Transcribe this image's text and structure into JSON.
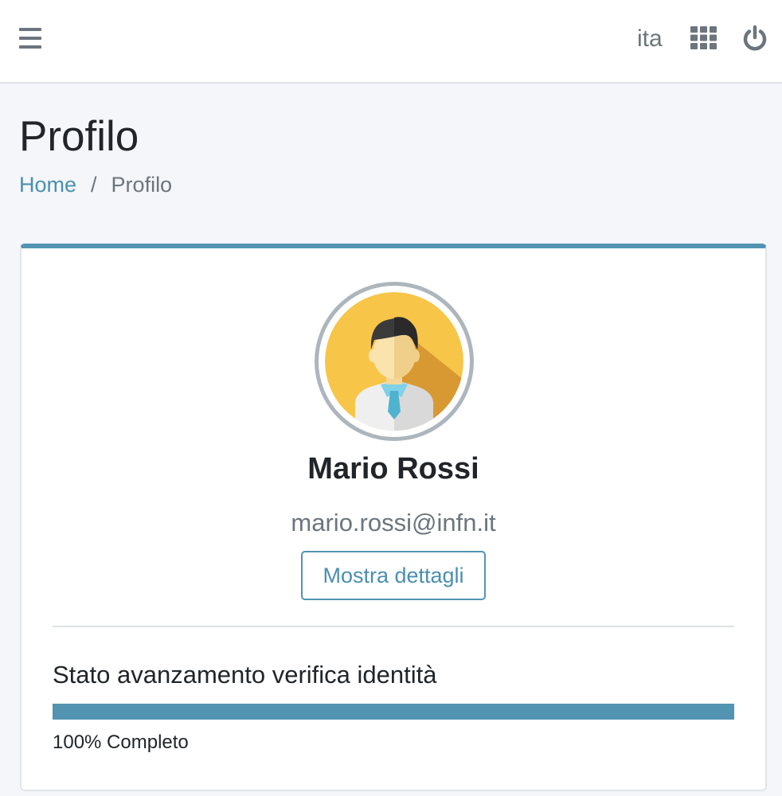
{
  "topbar": {
    "menu_icon": "hamburger-menu-icon",
    "language": "ita",
    "apps_icon": "grid-apps-icon",
    "power_icon": "power-icon"
  },
  "page": {
    "title": "Profilo",
    "breadcrumb": {
      "home": "Home",
      "separator": "/",
      "current": "Profilo"
    }
  },
  "profile": {
    "avatar_icon": "user-avatar-icon",
    "name": "Mario Rossi",
    "email": "mario.rossi@infn.it",
    "details_button": "Mostra dettagli"
  },
  "verification": {
    "title": "Stato avanzamento verifica identità",
    "progress_percent": 100,
    "progress_label": "100% Completo"
  },
  "colors": {
    "accent": "#5294b1",
    "link": "#4a90b0",
    "muted_text": "#6c757d",
    "avatar_bg": "#f7c548"
  }
}
